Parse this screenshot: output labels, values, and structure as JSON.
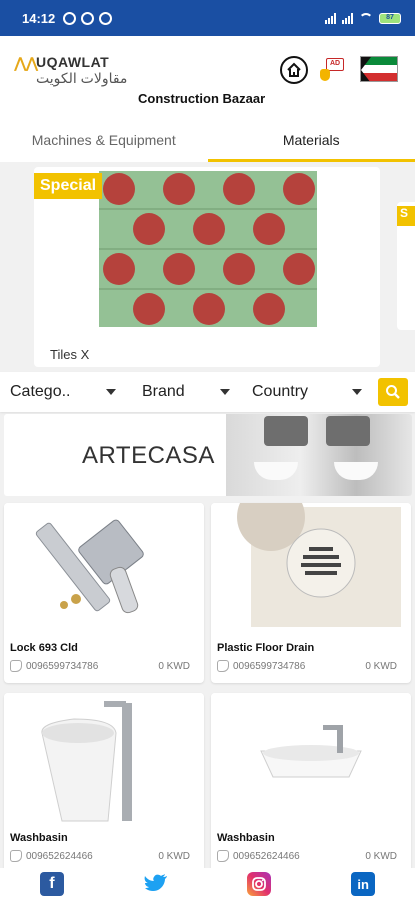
{
  "status_bar": {
    "time": "14:12",
    "battery": "87"
  },
  "header": {
    "logo_text": "UQAWLAT",
    "logo_arabic": "مقاولات الكويت",
    "brand_title": "Construction Bazaar",
    "ad_label": "AD"
  },
  "tabs": [
    {
      "label": "Machines & Equipment",
      "active": false
    },
    {
      "label": "Materials",
      "active": true
    }
  ],
  "banner": {
    "badge": "Special",
    "caption": "Tiles X",
    "next_badge": "S"
  },
  "filters": {
    "category": "Catego..",
    "brand": "Brand",
    "country": "Country"
  },
  "brand_banner": {
    "name": "ARTECASA"
  },
  "products": [
    {
      "title": "Lock 693 Cld",
      "phone": "0096599734786",
      "price": "0 KWD"
    },
    {
      "title": "Plastic Floor Drain",
      "phone": "0096599734786",
      "price": "0 KWD"
    },
    {
      "title": "Washbasin",
      "phone": "009652624466",
      "price": "0 KWD"
    },
    {
      "title": "Washbasin",
      "phone": "009652624466",
      "price": "0 KWD"
    }
  ],
  "colors": {
    "status_bar": "#1a4fa3",
    "accent": "#f2c200",
    "facebook": "#2c5aa0",
    "twitter": "#1da1f2",
    "linkedin": "#0a66c2"
  },
  "social": {
    "facebook": "f",
    "linkedin": "in"
  }
}
